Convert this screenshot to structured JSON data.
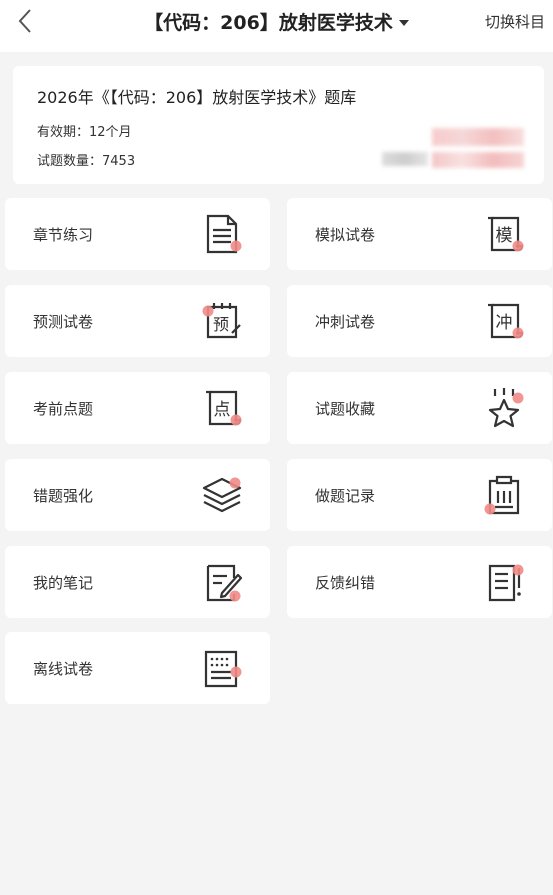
{
  "header": {
    "title": "【代码：206】放射医学技术",
    "switch_label": "切换科目"
  },
  "info": {
    "title": "2026年《【代码：206】放射医学技术》题库",
    "validity_label": "有效期：",
    "validity_value": "12个月",
    "count_label": "试题数量：",
    "count_value": "7453"
  },
  "tiles": [
    {
      "label": "章节练习",
      "icon": "document-icon"
    },
    {
      "label": "模拟试卷",
      "icon": "scroll-mo-icon"
    },
    {
      "label": "预测试卷",
      "icon": "clipboard-yu-icon"
    },
    {
      "label": "冲刺试卷",
      "icon": "scroll-chong-icon"
    },
    {
      "label": "考前点题",
      "icon": "scroll-dian-icon"
    },
    {
      "label": "试题收藏",
      "icon": "star-icon"
    },
    {
      "label": "错题强化",
      "icon": "layers-icon"
    },
    {
      "label": "做题记录",
      "icon": "clipboard-record-icon"
    },
    {
      "label": "我的笔记",
      "icon": "note-pencil-icon"
    },
    {
      "label": "反馈纠错",
      "icon": "feedback-icon"
    },
    {
      "label": "离线试卷",
      "icon": "offline-paper-icon"
    }
  ],
  "colors": {
    "accent_dot": "#f08b87",
    "icon_stroke": "#333333",
    "background": "#f4f4f4",
    "card": "#ffffff"
  },
  "icon_glyphs": {
    "mo": "模",
    "yu": "预",
    "chong": "冲",
    "dian": "点"
  }
}
